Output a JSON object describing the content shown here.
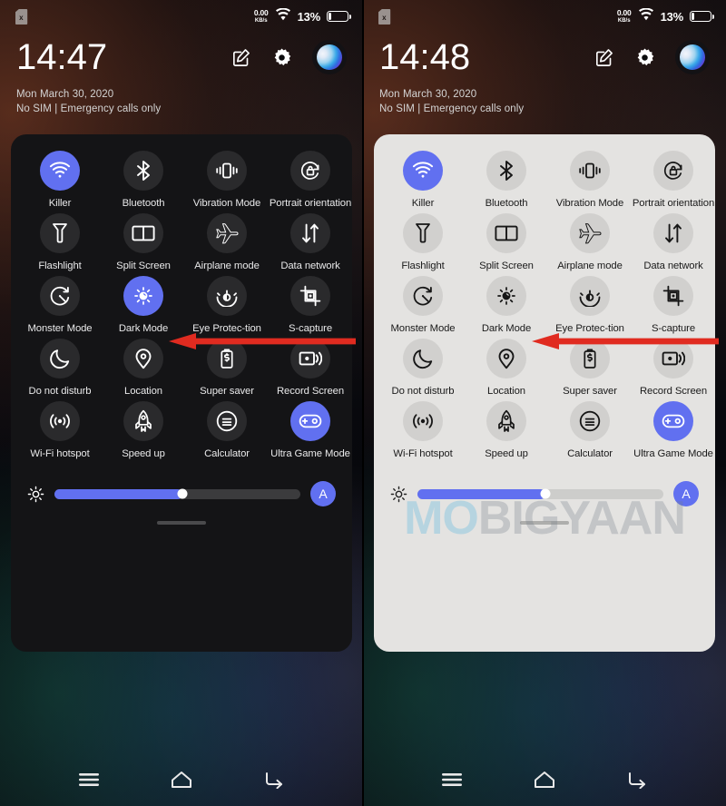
{
  "meta": {
    "accent_blue": "#6170f0",
    "panel_dark_bg": "#141416",
    "panel_light_bg": "#e4e3e1",
    "watermark": "MOBIGYAAN"
  },
  "phones": [
    {
      "id": "left-dark-mode-on",
      "theme": "dark",
      "statusbar": {
        "sim_icon": "sim-card-x-icon",
        "net_speed_value": "0.00",
        "net_speed_unit": "KB/s",
        "wifi_icon": "wifi-icon",
        "battery_percent": "13%",
        "battery_icon": "battery-low-icon"
      },
      "header": {
        "clock": "14:47",
        "date": "Mon March 30, 2020",
        "carrier": "No SIM | Emergency calls only",
        "edit_icon": "edit-pencil-icon",
        "settings_icon": "gear-icon",
        "avatar_icon": "user-avatar-orb"
      },
      "tiles": [
        {
          "label": "Killer",
          "icon": "wifi-icon",
          "on": true
        },
        {
          "label": "Bluetooth",
          "icon": "bluetooth-icon",
          "on": false
        },
        {
          "label": "Vibration Mode",
          "icon": "vibration-icon",
          "on": false
        },
        {
          "label": "Portrait orientation",
          "icon": "rotation-lock-icon",
          "on": false
        },
        {
          "label": "Flashlight",
          "icon": "flashlight-icon",
          "on": false
        },
        {
          "label": "Split Screen",
          "icon": "split-screen-icon",
          "on": false
        },
        {
          "label": "Airplane mode",
          "icon": "airplane-icon",
          "on": false
        },
        {
          "label": "Data network",
          "icon": "data-transfer-icon",
          "on": false
        },
        {
          "label": "Monster Mode",
          "icon": "monster-mode-icon",
          "on": false
        },
        {
          "label": "Dark Mode",
          "icon": "dark-mode-icon",
          "on": true
        },
        {
          "label": "Eye Protec-tion",
          "icon": "eye-protection-icon",
          "on": false
        },
        {
          "label": "S-capture",
          "icon": "screen-capture-icon",
          "on": false
        },
        {
          "label": "Do not disturb",
          "icon": "moon-icon",
          "on": false
        },
        {
          "label": "Location",
          "icon": "location-pin-icon",
          "on": false
        },
        {
          "label": "Super saver",
          "icon": "battery-saver-icon",
          "on": false
        },
        {
          "label": "Record Screen",
          "icon": "record-screen-icon",
          "on": false
        },
        {
          "label": "Wi-Fi hotspot",
          "icon": "hotspot-icon",
          "on": false
        },
        {
          "label": "Speed up",
          "icon": "rocket-icon",
          "on": false
        },
        {
          "label": "Calculator",
          "icon": "calculator-icon",
          "on": false
        },
        {
          "label": "Ultra Game Mode",
          "icon": "gamepad-icon",
          "on": true
        }
      ],
      "brightness": {
        "icon": "brightness-sun-icon",
        "value_percent": 52,
        "auto_label": "A"
      },
      "navbar": {
        "menu_icon": "menu-icon",
        "home_icon": "home-icon",
        "back_icon": "back-icon"
      }
    },
    {
      "id": "right-dark-mode-off",
      "theme": "light",
      "statusbar": {
        "sim_icon": "sim-card-x-icon",
        "net_speed_value": "0.00",
        "net_speed_unit": "KB/s",
        "wifi_icon": "wifi-icon",
        "battery_percent": "13%",
        "battery_icon": "battery-low-icon"
      },
      "header": {
        "clock": "14:48",
        "date": "Mon March 30, 2020",
        "carrier": "No SIM | Emergency calls only",
        "edit_icon": "edit-pencil-icon",
        "settings_icon": "gear-icon",
        "avatar_icon": "user-avatar-orb"
      },
      "tiles": [
        {
          "label": "Killer",
          "icon": "wifi-icon",
          "on": true
        },
        {
          "label": "Bluetooth",
          "icon": "bluetooth-icon",
          "on": false
        },
        {
          "label": "Vibration Mode",
          "icon": "vibration-icon",
          "on": false
        },
        {
          "label": "Portrait orientation",
          "icon": "rotation-lock-icon",
          "on": false
        },
        {
          "label": "Flashlight",
          "icon": "flashlight-icon",
          "on": false
        },
        {
          "label": "Split Screen",
          "icon": "split-screen-icon",
          "on": false
        },
        {
          "label": "Airplane mode",
          "icon": "airplane-icon",
          "on": false
        },
        {
          "label": "Data network",
          "icon": "data-transfer-icon",
          "on": false
        },
        {
          "label": "Monster Mode",
          "icon": "monster-mode-icon",
          "on": false
        },
        {
          "label": "Dark Mode",
          "icon": "dark-mode-icon",
          "on": false
        },
        {
          "label": "Eye Protec-tion",
          "icon": "eye-protection-icon",
          "on": false
        },
        {
          "label": "S-capture",
          "icon": "screen-capture-icon",
          "on": false
        },
        {
          "label": "Do not disturb",
          "icon": "moon-icon",
          "on": false
        },
        {
          "label": "Location",
          "icon": "location-pin-icon",
          "on": false
        },
        {
          "label": "Super saver",
          "icon": "battery-saver-icon",
          "on": false
        },
        {
          "label": "Record Screen",
          "icon": "record-screen-icon",
          "on": false
        },
        {
          "label": "Wi-Fi hotspot",
          "icon": "hotspot-icon",
          "on": false
        },
        {
          "label": "Speed up",
          "icon": "rocket-icon",
          "on": false
        },
        {
          "label": "Calculator",
          "icon": "calculator-icon",
          "on": false
        },
        {
          "label": "Ultra Game Mode",
          "icon": "gamepad-icon",
          "on": true
        }
      ],
      "brightness": {
        "icon": "brightness-sun-icon",
        "value_percent": 52,
        "auto_label": "A"
      },
      "navbar": {
        "menu_icon": "menu-icon",
        "home_icon": "home-icon",
        "back_icon": "back-icon"
      }
    }
  ],
  "annotations": [
    {
      "type": "arrow",
      "direction": "left",
      "color": "#e02b20",
      "points_at": "Dark Mode tile",
      "panel": "left"
    },
    {
      "type": "arrow",
      "direction": "left",
      "color": "#e02b20",
      "points_at": "Dark Mode tile",
      "panel": "right"
    }
  ]
}
